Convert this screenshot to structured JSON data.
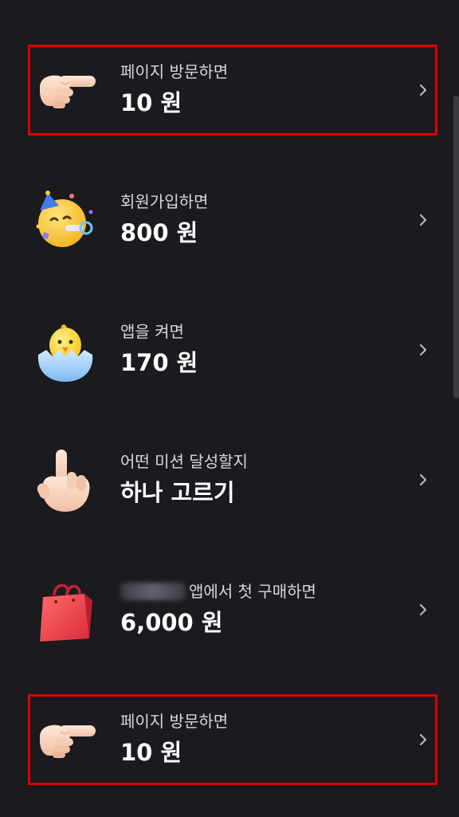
{
  "items": [
    {
      "label": "페이지 방문하면",
      "value": "10 원",
      "icon": "pointing-hand-icon",
      "highlighted": true
    },
    {
      "label": "회원가입하면",
      "value": "800 원",
      "icon": "party-face-icon",
      "highlighted": false
    },
    {
      "label": "앱을 켜면",
      "value": "170 원",
      "icon": "hatching-chick-icon",
      "highlighted": false
    },
    {
      "label": "어떤 미션 달성할지",
      "value": "하나 고르기",
      "icon": "pointing-up-hand-icon",
      "highlighted": false
    },
    {
      "label": "앱에서 첫 구매하면",
      "value": "6,000 원",
      "icon": "shopping-bag-icon",
      "highlighted": false
    },
    {
      "label": "페이지 방문하면",
      "value": "10 원",
      "icon": "pointing-hand-icon",
      "highlighted": true
    }
  ],
  "colors": {
    "background": "#1a1a1f",
    "highlight_border": "#e00000",
    "chevron": "#b4b4ba"
  }
}
